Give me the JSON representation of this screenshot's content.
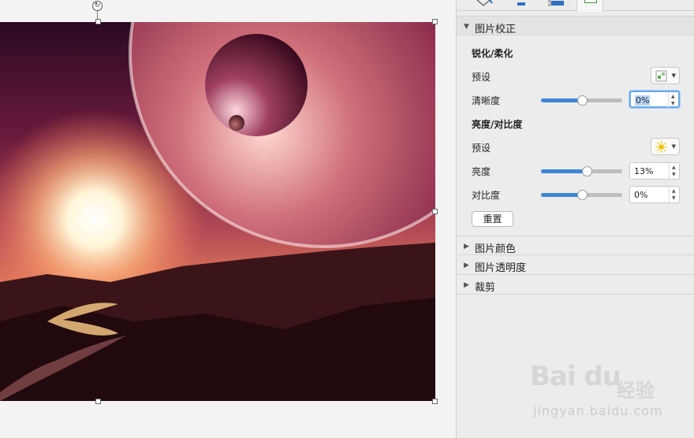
{
  "canvas": {
    "rotate_glyph": "↻"
  },
  "panel": {
    "sections": {
      "picture_correction": "图片校正",
      "picture_color": "图片颜色",
      "picture_transparency": "图片透明度",
      "crop": "裁剪"
    },
    "sharpen_soften": {
      "title": "锐化/柔化",
      "preset_label": "预设",
      "sharpness_label": "清晰度",
      "sharpness_value": "0%",
      "sharpness_fraction": 0.5
    },
    "brightness_contrast": {
      "title": "亮度/对比度",
      "preset_label": "预设",
      "brightness_label": "亮度",
      "brightness_value": "13%",
      "brightness_fraction": 0.565,
      "contrast_label": "对比度",
      "contrast_value": "0%",
      "contrast_fraction": 0.5
    },
    "reset_label": "重置",
    "tri_collapsed": "▶",
    "tri_expanded": "▼"
  },
  "watermark": {
    "logo": "Bai du",
    "cn": "经验",
    "url": "jingyan.baidu.com"
  },
  "colors": {
    "accent": "#3d86d6",
    "focus": "#6aa8ee"
  },
  "icons": {
    "sharpen_preset": "sharpen-preset-icon",
    "brightness_preset": "sun-icon",
    "rotate": "rotate-icon"
  }
}
